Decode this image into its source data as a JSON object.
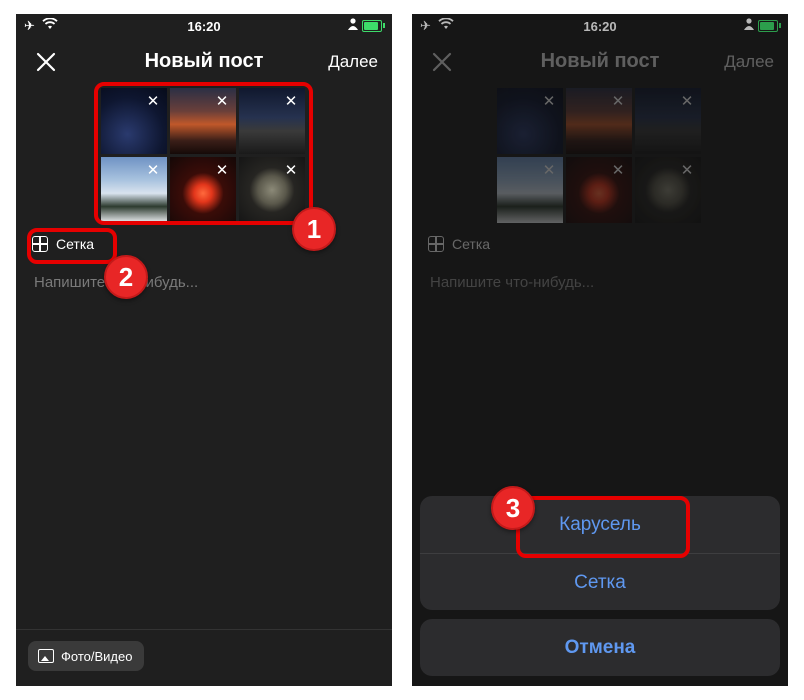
{
  "colors": {
    "accent_blue": "#5f98f0",
    "highlight_red": "#e60000",
    "battery_green": "#3ddc6a",
    "background": "#1f1f1f"
  },
  "status_bar": {
    "time": "16:20"
  },
  "header": {
    "close_icon": "close-icon",
    "title": "Новый пост",
    "next_label": "Далее"
  },
  "media_grid": {
    "thumbnails": [
      "city-night-mosque",
      "sunset-sea",
      "night-street",
      "snowy-mountains",
      "red-moon",
      "owl"
    ]
  },
  "grid_toggle": {
    "label": "Сетка"
  },
  "caption": {
    "placeholder": "Напишите что-нибудь..."
  },
  "bottom_bar": {
    "media_button_label": "Фото/Видео"
  },
  "action_sheet": {
    "options": [
      "Карусель",
      "Сетка"
    ],
    "cancel_label": "Отмена"
  },
  "callouts": [
    "1",
    "2",
    "3"
  ]
}
